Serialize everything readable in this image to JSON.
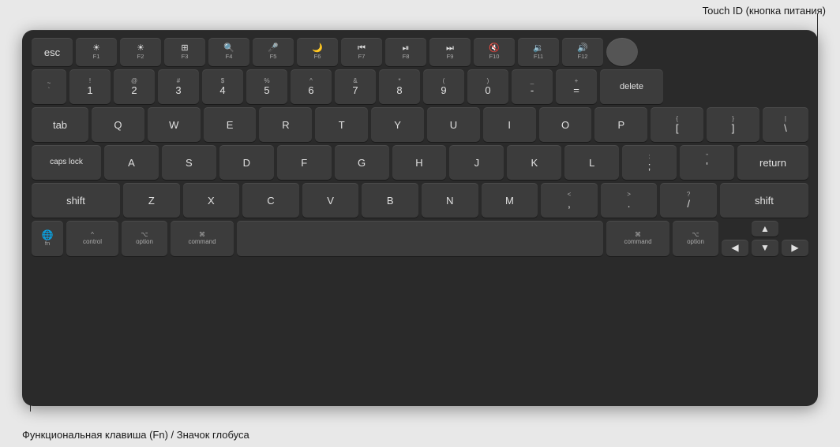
{
  "labels": {
    "touchid": "Touch ID (кнопка питания)",
    "fn": "Функциональная клавиша (Fn) / Значок глобуса"
  },
  "keyboard": {
    "rows": {
      "fn_row": [
        "esc",
        "F1",
        "F2",
        "F3",
        "F4",
        "F5",
        "F6",
        "F7",
        "F8",
        "F9",
        "F10",
        "F11",
        "F12"
      ],
      "num_row": [
        "`",
        "1",
        "2",
        "3",
        "4",
        "5",
        "6",
        "7",
        "8",
        "9",
        "0",
        "-",
        "=",
        "delete"
      ],
      "tab_row": [
        "tab",
        "Q",
        "W",
        "E",
        "R",
        "T",
        "Y",
        "U",
        "I",
        "O",
        "P",
        "[",
        "]",
        "\\"
      ],
      "caps_row": [
        "caps lock",
        "A",
        "S",
        "D",
        "F",
        "G",
        "H",
        "J",
        "K",
        "L",
        ";",
        "'",
        "return"
      ],
      "shift_row": [
        "shift",
        "Z",
        "X",
        "C",
        "V",
        "B",
        "N",
        "M",
        ",",
        ".",
        "/",
        "shift"
      ],
      "bottom_row": [
        "fn",
        "control",
        "option",
        "command",
        "space",
        "command",
        "option",
        "arrows"
      ]
    }
  }
}
